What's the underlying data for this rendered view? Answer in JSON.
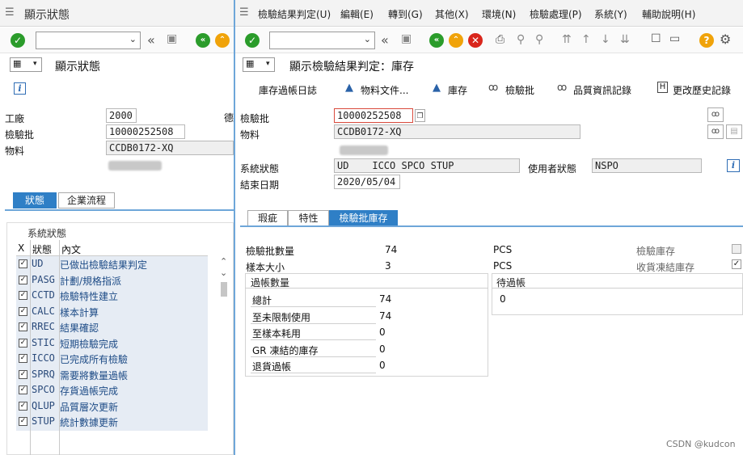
{
  "left": {
    "title": "顯示狀態",
    "screen_header": "顯示狀態",
    "fields": {
      "plant_label": "工廠",
      "plant_value": "2000",
      "plant_extra": "德",
      "lot_label": "檢驗批",
      "lot_value": "10000252508",
      "material_label": "物料",
      "material_value": "CCDB0172-XQ"
    },
    "tabs": [
      "狀態",
      "企業流程"
    ],
    "status_group_label": "系統狀態",
    "columns": [
      "X",
      "狀態",
      "內文"
    ],
    "statuses": [
      {
        "code": "UD",
        "text": "已做出檢驗結果判定"
      },
      {
        "code": "PASG",
        "text": "計劃/規格指派"
      },
      {
        "code": "CCTD",
        "text": "檢驗特性建立"
      },
      {
        "code": "CALC",
        "text": "樣本計算"
      },
      {
        "code": "RREC",
        "text": "結果確認"
      },
      {
        "code": "STIC",
        "text": "短期檢驗完成"
      },
      {
        "code": "ICCO",
        "text": "已完成所有檢驗"
      },
      {
        "code": "SPRQ",
        "text": "需要將數量過帳"
      },
      {
        "code": "SPCO",
        "text": "存貨過帳完成"
      },
      {
        "code": "QLUP",
        "text": "品質層次更新"
      },
      {
        "code": "STUP",
        "text": "統計數據更新"
      }
    ]
  },
  "right": {
    "menu": [
      "檢驗結果判定(U)",
      "編輯(E)",
      "轉到(G)",
      "其他(X)",
      "環境(N)",
      "檢驗處理(P)",
      "系統(Y)",
      "輔助說明(H)"
    ],
    "screen_title": "顯示檢驗結果判定：庫存",
    "app_toolbar": [
      "庫存過帳日誌",
      "物料文件...",
      "庫存",
      "檢驗批",
      "品質資訊記錄",
      "更改歷史記錄"
    ],
    "header": {
      "lot_label": "檢驗批",
      "lot_value": "10000252508",
      "material_label": "物料",
      "material_value": "CCDB0172-XQ",
      "sys_status_label": "系統狀態",
      "sys_status_value": "UD    ICCO SPCO STUP",
      "user_status_label": "使用者狀態",
      "user_status_value": "NSPO",
      "end_date_label": "結束日期",
      "end_date_value": "2020/05/04"
    },
    "tabs": [
      "瑕疵",
      "特性",
      "檢驗批庫存"
    ],
    "stock": {
      "lot_qty_label": "檢驗批數量",
      "lot_qty_value": "74",
      "lot_qty_unit": "PCS",
      "sample_label": "樣本大小",
      "sample_value": "3",
      "sample_unit": "PCS",
      "insp_stock_label": "檢驗庫存",
      "blocked_label": "收貨凍結庫存",
      "posted_header": "過帳數量",
      "to_post_header": "待過帳",
      "to_post_value": "0",
      "rows": [
        {
          "label": "總計",
          "value": "74"
        },
        {
          "label": "至未限制使用",
          "value": "74"
        },
        {
          "label": "至樣本耗用",
          "value": "0"
        },
        {
          "label": "GR 凍結的庫存",
          "value": "0"
        },
        {
          "label": "退貨過帳",
          "value": "0"
        }
      ]
    },
    "watermark": "CSDN @kudcon"
  }
}
